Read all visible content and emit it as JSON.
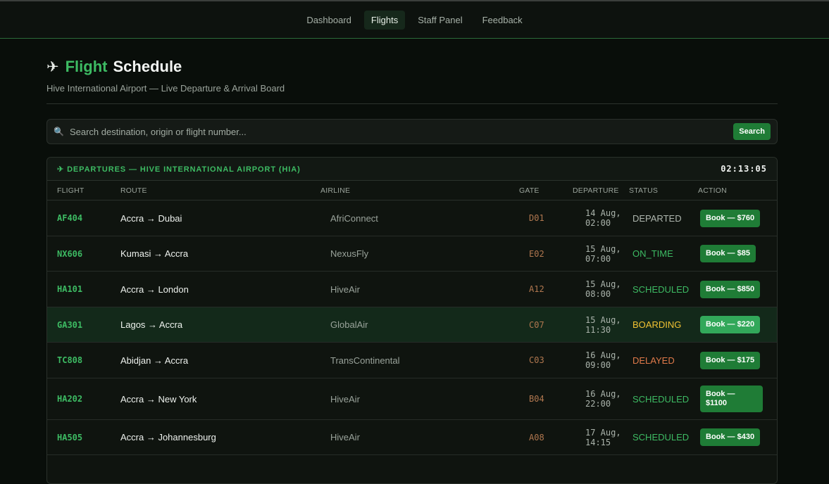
{
  "nav": {
    "items": [
      {
        "label": "Dashboard",
        "active": false
      },
      {
        "label": "Flights",
        "active": true
      },
      {
        "label": "Staff Panel",
        "active": false
      },
      {
        "label": "Feedback",
        "active": false
      }
    ]
  },
  "header": {
    "icon": "airplane-icon",
    "title_word1": "Flight",
    "title_word2": "Schedule",
    "subtitle": "Hive International Airport — Live Departure & Arrival Board"
  },
  "search": {
    "icon": "search-icon",
    "placeholder": "Search destination, origin or flight number...",
    "value": "",
    "button_label": "Search"
  },
  "board": {
    "title": "✈ DEPARTURES — HIVE INTERNATIONAL AIRPORT (HIA)",
    "clock": "02:13:05",
    "columns": [
      "FLIGHT",
      "ROUTE",
      "AIRLINE",
      "GATE",
      "DEPARTURE",
      "STATUS",
      "ACTION"
    ],
    "rows": [
      {
        "flight": "AF404",
        "route": "Accra → Dubai",
        "airline": "AfriConnect",
        "gate": "D01",
        "dep_date": "14 Aug,",
        "dep_time": "02:00",
        "status": "DEPARTED",
        "status_color": "#aeb6ae",
        "action_line1": "Book — $760",
        "action_line2": ""
      },
      {
        "flight": "NX606",
        "route": "Kumasi → Accra",
        "airline": "NexusFly",
        "gate": "E02",
        "dep_date": "15 Aug,",
        "dep_time": "07:00",
        "status": "ON_TIME",
        "status_color": "#3dbb63",
        "action_line1": "Book — $85",
        "action_line2": ""
      },
      {
        "flight": "HA101",
        "route": "Accra → London",
        "airline": "HiveAir",
        "gate": "A12",
        "dep_date": "15 Aug,",
        "dep_time": "08:00",
        "status": "SCHEDULED",
        "status_color": "#3dbb63",
        "action_line1": "Book — $850",
        "action_line2": ""
      },
      {
        "flight": "GA301",
        "route": "Lagos → Accra",
        "airline": "GlobalAir",
        "gate": "C07",
        "dep_date": "15 Aug,",
        "dep_time": "11:30",
        "status": "BOARDING",
        "status_color": "#f1c232",
        "action_line1": "Book — $220",
        "action_line2": ""
      },
      {
        "flight": "TC808",
        "route": "Abidjan → Accra",
        "airline": "TransContinental",
        "gate": "C03",
        "dep_date": "16 Aug,",
        "dep_time": "09:00",
        "status": "DELAYED",
        "status_color": "#e07a4a",
        "action_line1": "Book — $175",
        "action_line2": ""
      },
      {
        "flight": "HA202",
        "route": "Accra → New York",
        "airline": "HiveAir",
        "gate": "B04",
        "dep_date": "16 Aug,",
        "dep_time": "22:00",
        "status": "SCHEDULED",
        "status_color": "#3dbb63",
        "action_line1": "Book —",
        "action_line2": "$1100"
      },
      {
        "flight": "HA505",
        "route": "Accra → Johannesburg",
        "airline": "HiveAir",
        "gate": "A08",
        "dep_date": "17 Aug,",
        "dep_time": "14:15",
        "status": "SCHEDULED",
        "status_color": "#3dbb63",
        "action_line1": "Book — $430",
        "action_line2": ""
      }
    ]
  },
  "colors": {
    "accent": "#3dbb63",
    "button": "#1f7c36",
    "gate": "#b0774f",
    "boarding": "#f1c232",
    "delayed": "#e07a4a"
  }
}
